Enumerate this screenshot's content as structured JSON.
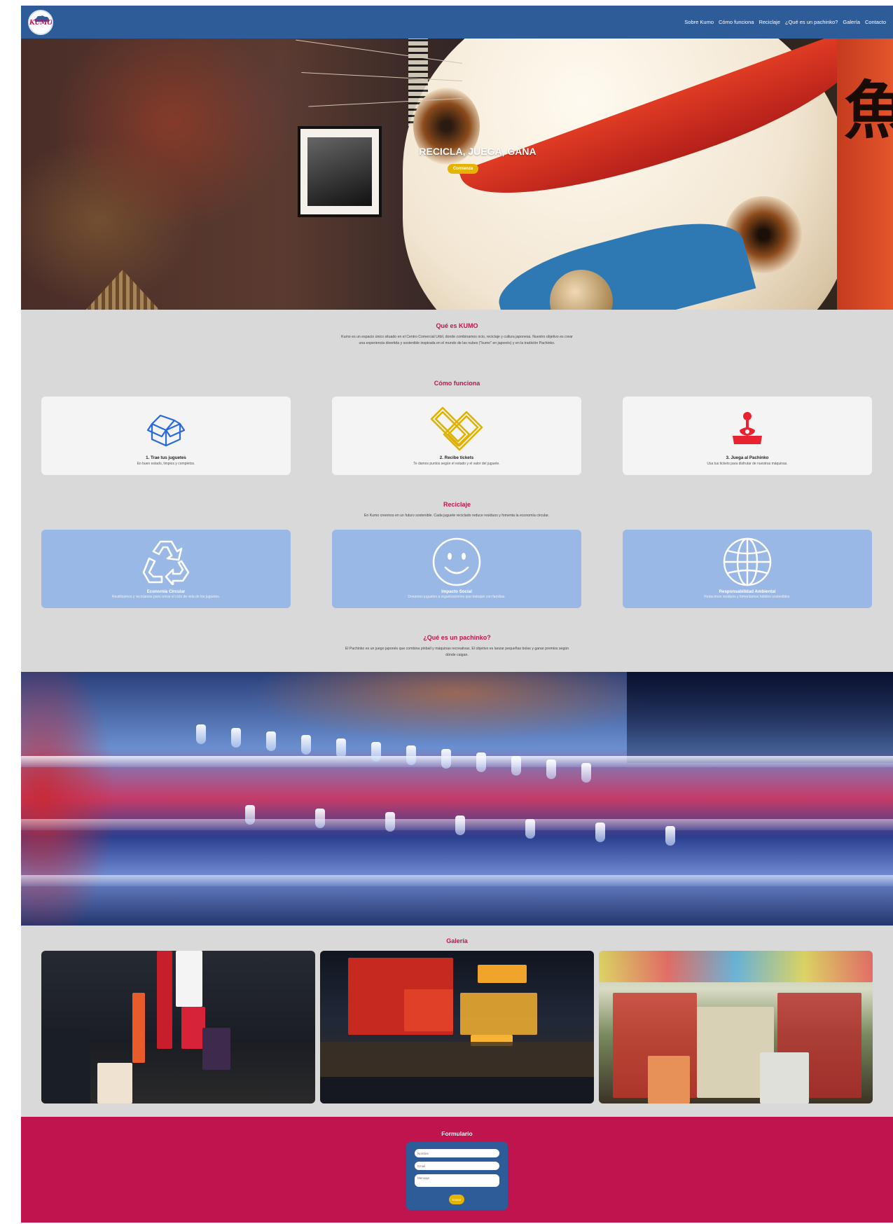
{
  "brand": {
    "logo_text": "KUMO"
  },
  "nav": [
    {
      "label": "Sobre Kumo"
    },
    {
      "label": "Cómo funciona"
    },
    {
      "label": "Reciclaje"
    },
    {
      "label": "¿Qué es un pachinko?"
    },
    {
      "label": "Galería"
    },
    {
      "label": "Contacto"
    }
  ],
  "hero": {
    "title": "RECICLA, JUEGA, GANA",
    "button": "Comienza"
  },
  "about": {
    "title": "Qué es KUMO",
    "text": "Kumo es un espacio único situado en el Centro Comercial Urbil, donde combinamos ocio, reciclaje y cultura japonesa. Nuestro objetivo es crear una experiencia divertida y sostenible inspirada en el mundo de las nubes (\"kumo\" en japonés) y en la tradición Pachinko."
  },
  "how": {
    "title": "Cómo funciona",
    "steps": [
      {
        "icon": "box-icon",
        "title": "1. Trae tus juguetes",
        "text": "En buen estado, limpios y completos."
      },
      {
        "icon": "tickets-icon",
        "title": "2. Recibe tickets",
        "text": "Te damos puntos según el estado y el valor del juguete."
      },
      {
        "icon": "joystick-icon",
        "title": "3. Juega al Pachinko",
        "text": "Usa tus tickets para disfrutar de nuestras máquinas."
      }
    ]
  },
  "recycle": {
    "title": "Reciclaje",
    "text": "En Kumo creemos en un futuro sostenible. Cada juguete reciclado reduce residuos y fomenta la economía circular.",
    "cards": [
      {
        "icon": "recycle-icon",
        "title": "Economía Circular",
        "text": "Reutilizamos y reciclamos para cerrar el ciclo de vida de los juguetes."
      },
      {
        "icon": "smile-icon",
        "title": "Impacto Social",
        "text": "Donamos juguetes a organizaciones que trabajan con familias."
      },
      {
        "icon": "globe-icon",
        "title": "Responsabilidad Ambiental",
        "text": "Reducimos residuos y fomentamos hábitos sostenibles."
      }
    ]
  },
  "pachinko": {
    "title": "¿Qué es un pachinko?",
    "text": "El Pachinko es un juego japonés que combina pinball y máquinas recreativas. El objetivo es lanzar pequeñas bolas y ganar premios según dónde caigan."
  },
  "gallery": {
    "title": "Galería"
  },
  "form": {
    "title": "Formulario",
    "name_placeholder": "Nombre",
    "email_placeholder": "Email",
    "message_placeholder": "Mensaje",
    "send": "Enviar"
  },
  "colors": {
    "nav": "#2e5c99",
    "accent": "#c0144f",
    "button": "#e6b400",
    "card_blue": "#9ab8e5",
    "background": "#d9d9d9"
  }
}
